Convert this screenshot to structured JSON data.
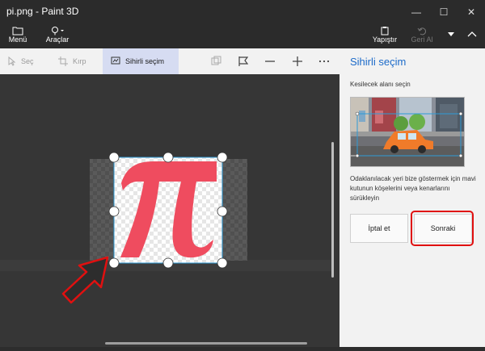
{
  "window": {
    "title": "pi.png - Paint 3D"
  },
  "menubar": {
    "menu_label": "Menü",
    "tools_label": "Araçlar",
    "paste_label": "Yapıştır",
    "undo_label": "Geri Al"
  },
  "toolbar": {
    "select_label": "Seç",
    "crop_label": "Kırp",
    "magic_select_label": "Sihirli seçim"
  },
  "panel": {
    "title": "Sihirli seçim",
    "subtitle": "Kesilecek alanı seçin",
    "description": "Odaklanılacak yeri bize göstermek için mavi kutunun köşelerini veya kenarlarını sürükleyin",
    "cancel_label": "İptal et",
    "next_label": "Sonraki"
  },
  "canvas": {
    "symbol": "π"
  },
  "colors": {
    "accent": "#1b6ac9",
    "pi": "#ef4c5f",
    "highlight": "#e01010"
  }
}
